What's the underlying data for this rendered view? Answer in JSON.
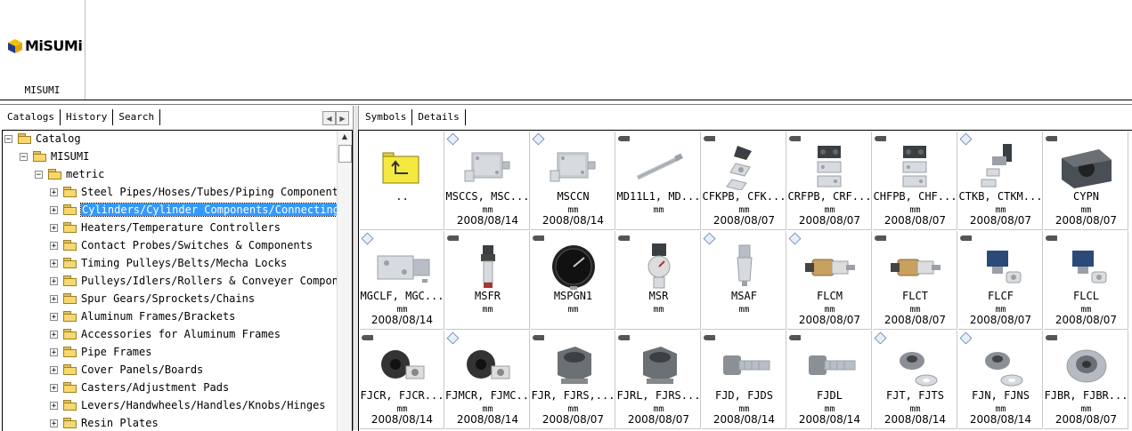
{
  "vendor": {
    "name": "MISUMI",
    "logo_text": "MiSUMi"
  },
  "left_pane": {
    "tabs": [
      {
        "label": "Catalogs"
      },
      {
        "label": "History"
      },
      {
        "label": "Search"
      }
    ],
    "tree": [
      {
        "label": "Catalog",
        "level": 0,
        "expanded": true
      },
      {
        "label": "MISUMI",
        "level": 1,
        "expanded": true
      },
      {
        "label": "metric",
        "level": 2,
        "expanded": true
      },
      {
        "label": "Steel Pipes/Hoses/Tubes/Piping Components",
        "level": 3,
        "expanded": false
      },
      {
        "label": "Cylinders/Cylinder Components/Connecting ",
        "level": 3,
        "expanded": false,
        "selected": true
      },
      {
        "label": "Heaters/Temperature Controllers",
        "level": 3,
        "expanded": false
      },
      {
        "label": "Contact Probes/Switches & Components",
        "level": 3,
        "expanded": false
      },
      {
        "label": "Timing Pulleys/Belts/Mecha Locks",
        "level": 3,
        "expanded": false
      },
      {
        "label": "Pulleys/Idlers/Rollers & Conveyer Compone",
        "level": 3,
        "expanded": false
      },
      {
        "label": "Spur Gears/Sprockets/Chains",
        "level": 3,
        "expanded": false
      },
      {
        "label": "Aluminum Frames/Brackets",
        "level": 3,
        "expanded": false
      },
      {
        "label": "Accessories for Aluminum Frames",
        "level": 3,
        "expanded": false
      },
      {
        "label": "Pipe Frames",
        "level": 3,
        "expanded": false
      },
      {
        "label": "Cover Panels/Boards",
        "level": 3,
        "expanded": false
      },
      {
        "label": "Casters/Adjustment Pads",
        "level": 3,
        "expanded": false
      },
      {
        "label": "Levers/Handwheels/Handles/Knobs/Hinges",
        "level": 3,
        "expanded": false
      },
      {
        "label": "Resin Plates",
        "level": 3,
        "expanded": false
      }
    ]
  },
  "right_pane": {
    "tabs": [
      {
        "label": "Symbols"
      },
      {
        "label": "Details"
      }
    ],
    "items": [
      {
        "name": "..",
        "unit": "",
        "date": "",
        "badge": "",
        "icon": "folder-up-icon"
      },
      {
        "name": "MSCCS, MSC...",
        "unit": "mm",
        "date": "2008/08/14",
        "badge": "cad",
        "icon": "compact-cylinder-icon"
      },
      {
        "name": "MSCCN",
        "unit": "mm",
        "date": "2008/08/14",
        "badge": "cad",
        "icon": "compact-cylinder-icon"
      },
      {
        "name": "MD11L1, MD...",
        "unit": "mm",
        "date": "",
        "badge": "screw",
        "icon": "pen-cylinder-icon"
      },
      {
        "name": "CFKPB, CFK...",
        "unit": "mm",
        "date": "2008/08/07",
        "badge": "screw",
        "icon": "bracket-icon"
      },
      {
        "name": "CRFPB, CRF...",
        "unit": "mm",
        "date": "2008/08/07",
        "badge": "screw",
        "icon": "plate-bracket-icon"
      },
      {
        "name": "CHFPB, CHF...",
        "unit": "mm",
        "date": "2008/08/07",
        "badge": "screw",
        "icon": "plate-bracket-icon"
      },
      {
        "name": "CTKB, CTKM...",
        "unit": "mm",
        "date": "2008/08/07",
        "badge": "cad",
        "icon": "clevis-icon"
      },
      {
        "name": "CYPN",
        "unit": "mm",
        "date": "2008/08/07",
        "badge": "screw",
        "icon": "block-icon"
      },
      {
        "name": "MGCLF, MGC...",
        "unit": "mm",
        "date": "2008/08/14",
        "badge": "cad",
        "icon": "guide-cylinder-icon"
      },
      {
        "name": "MSFR",
        "unit": "mm",
        "date": "",
        "badge": "screw",
        "icon": "filter-regulator-icon"
      },
      {
        "name": "MSPGN1",
        "unit": "mm",
        "date": "",
        "badge": "screw",
        "icon": "pressure-gauge-icon"
      },
      {
        "name": "MSR",
        "unit": "mm",
        "date": "",
        "badge": "screw",
        "icon": "regulator-icon"
      },
      {
        "name": "MSAF",
        "unit": "mm",
        "date": "",
        "badge": "cad",
        "icon": "air-filter-icon"
      },
      {
        "name": "FLCM",
        "unit": "mm",
        "date": "2008/08/07",
        "badge": "cad",
        "icon": "floating-joint-icon"
      },
      {
        "name": "FLCT",
        "unit": "mm",
        "date": "2008/08/07",
        "badge": "screw",
        "icon": "floating-joint-icon"
      },
      {
        "name": "FLCF",
        "unit": "mm",
        "date": "2008/08/07",
        "badge": "screw",
        "icon": "floating-joint-blue-icon"
      },
      {
        "name": "FLCL",
        "unit": "mm",
        "date": "2008/08/07",
        "badge": "screw",
        "icon": "floating-joint-blue-icon"
      },
      {
        "name": "FJCR, FJCR...",
        "unit": "mm",
        "date": "2008/08/14",
        "badge": "screw",
        "icon": "flange-joint-icon"
      },
      {
        "name": "FJMCR, FJMC...",
        "unit": "mm",
        "date": "2008/08/14",
        "badge": "cad",
        "icon": "flange-joint-icon"
      },
      {
        "name": "FJR, FJRS,...",
        "unit": "mm",
        "date": "2008/08/07",
        "badge": "screw",
        "icon": "hex-nut-icon"
      },
      {
        "name": "FJRL, FJRS...",
        "unit": "mm",
        "date": "2008/08/07",
        "badge": "screw",
        "icon": "hex-nut-icon"
      },
      {
        "name": "FJD, FJDS",
        "unit": "mm",
        "date": "2008/08/14",
        "badge": "screw",
        "icon": "bolt-icon"
      },
      {
        "name": "FJDL",
        "unit": "mm",
        "date": "2008/08/14",
        "badge": "screw",
        "icon": "bolt-icon"
      },
      {
        "name": "FJT, FJTS",
        "unit": "mm",
        "date": "2008/08/14",
        "badge": "cad",
        "icon": "washer-joint-icon"
      },
      {
        "name": "FJN, FJNS",
        "unit": "mm",
        "date": "2008/08/14",
        "badge": "cad",
        "icon": "washer-joint-icon"
      },
      {
        "name": "FJBR, FJBR...",
        "unit": "mm",
        "date": "2008/08/07",
        "badge": "screw",
        "icon": "bearing-icon"
      }
    ]
  }
}
